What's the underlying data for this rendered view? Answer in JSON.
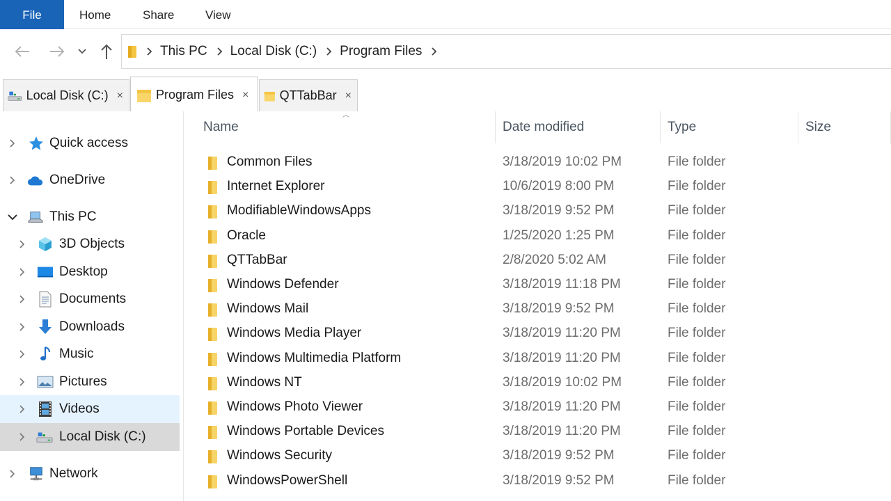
{
  "ribbon": {
    "tabs": [
      "File",
      "Home",
      "Share",
      "View"
    ]
  },
  "nav": {
    "icons": [
      "back-arrow-icon",
      "forward-arrow-icon",
      "recent-chevron-icon",
      "up-arrow-icon"
    ]
  },
  "address": {
    "crumbs": [
      "This PC",
      "Local Disk (C:)",
      "Program Files"
    ]
  },
  "tabs": [
    {
      "label": "Local Disk (C:)",
      "close": "×",
      "icon": "drive-icon",
      "active": false
    },
    {
      "label": "Program Files",
      "close": "×",
      "icon": "folder-icon",
      "active": true
    },
    {
      "label": "QTTabBar",
      "close": "×",
      "icon": "folder-icon",
      "active": false
    }
  ],
  "sidebar": {
    "items": [
      {
        "label": "Quick access",
        "icon": "star-icon"
      },
      {
        "label": "OneDrive",
        "icon": "cloud-icon"
      },
      {
        "label": "This PC",
        "icon": "computer-icon"
      },
      {
        "label": "3D Objects",
        "icon": "cube-icon"
      },
      {
        "label": "Desktop",
        "icon": "desktop-icon"
      },
      {
        "label": "Documents",
        "icon": "document-icon"
      },
      {
        "label": "Downloads",
        "icon": "download-icon"
      },
      {
        "label": "Music",
        "icon": "music-note-icon"
      },
      {
        "label": "Pictures",
        "icon": "picture-icon"
      },
      {
        "label": "Videos",
        "icon": "film-icon"
      },
      {
        "label": "Local Disk (C:)",
        "icon": "drive-icon"
      },
      {
        "label": "Network",
        "icon": "network-icon"
      }
    ]
  },
  "columns": {
    "name": "Name",
    "date": "Date modified",
    "type": "Type",
    "size": "Size"
  },
  "files": [
    {
      "name": "Common Files",
      "date": "3/18/2019 10:02 PM",
      "type": "File folder"
    },
    {
      "name": "Internet Explorer",
      "date": "10/6/2019 8:00 PM",
      "type": "File folder"
    },
    {
      "name": "ModifiableWindowsApps",
      "date": "3/18/2019 9:52 PM",
      "type": "File folder"
    },
    {
      "name": "Oracle",
      "date": "1/25/2020 1:25 PM",
      "type": "File folder"
    },
    {
      "name": "QTTabBar",
      "date": "2/8/2020 5:02 AM",
      "type": "File folder"
    },
    {
      "name": "Windows Defender",
      "date": "3/18/2019 11:18 PM",
      "type": "File folder"
    },
    {
      "name": "Windows Mail",
      "date": "3/18/2019 9:52 PM",
      "type": "File folder"
    },
    {
      "name": "Windows Media Player",
      "date": "3/18/2019 11:20 PM",
      "type": "File folder"
    },
    {
      "name": "Windows Multimedia Platform",
      "date": "3/18/2019 11:20 PM",
      "type": "File folder"
    },
    {
      "name": "Windows NT",
      "date": "3/18/2019 10:02 PM",
      "type": "File folder"
    },
    {
      "name": "Windows Photo Viewer",
      "date": "3/18/2019 11:20 PM",
      "type": "File folder"
    },
    {
      "name": "Windows Portable Devices",
      "date": "3/18/2019 11:20 PM",
      "type": "File folder"
    },
    {
      "name": "Windows Security",
      "date": "3/18/2019 9:52 PM",
      "type": "File folder"
    },
    {
      "name": "WindowsPowerShell",
      "date": "3/18/2019 9:52 PM",
      "type": "File folder"
    }
  ],
  "colors": {
    "accent": "#1a64b8",
    "folder": "#f4c542",
    "hover": "#e5f3ff",
    "selected": "#d9d9d9"
  }
}
